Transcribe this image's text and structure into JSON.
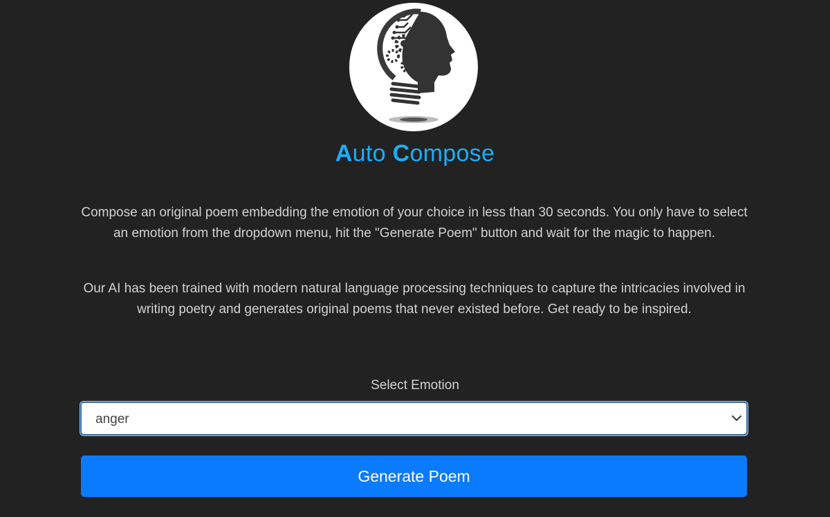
{
  "header": {
    "logo_icon": "ai-head-lightbulb-logo",
    "title_part1_cap": "A",
    "title_part1_rest": "uto ",
    "title_part2_cap": "C",
    "title_part2_rest": "ompose",
    "title_color": "#1aaefb"
  },
  "main": {
    "description_1": "Compose an original poem embedding the emotion of your choice in less than 30 seconds. You only have to select an emotion from the dropdown menu, hit the \"Generate Poem\" button and wait for the magic to happen.",
    "description_2": "Our AI has been trained with modern natural language processing techniques to capture the intricacies involved in writing poetry and generates original poems that never existed before. Get ready to be inspired.",
    "select_label": "Select Emotion",
    "select_value": "anger",
    "select_icon": "chevron-down-icon",
    "generate_button_label": "Generate Poem",
    "button_color": "#0b7bfe"
  }
}
